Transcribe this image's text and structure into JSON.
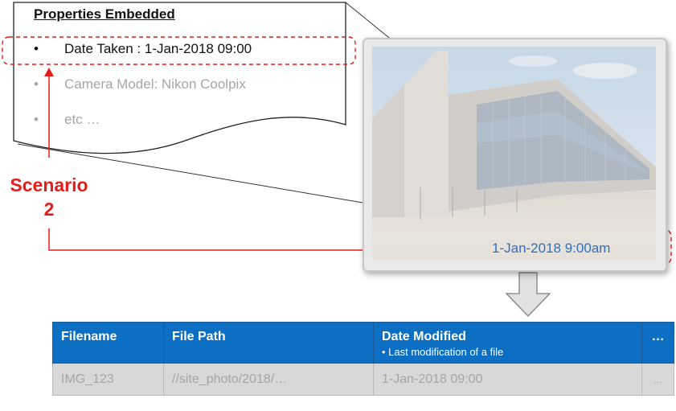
{
  "properties": {
    "title": "Properties Embedded",
    "items": [
      {
        "bullet": "•",
        "text": "Date Taken : 1-Jan-2018 09:00"
      },
      {
        "bullet": "•",
        "text": "Camera Model: Nikon Coolpix"
      },
      {
        "bullet": "•",
        "text": "etc …"
      }
    ]
  },
  "photo": {
    "date_stamp": "1-Jan-2018 9:00am"
  },
  "scenario": {
    "line1": "Scenario",
    "line2": "2"
  },
  "table": {
    "headers": [
      {
        "label": "Filename",
        "sub": ""
      },
      {
        "label": "File Path",
        "sub": ""
      },
      {
        "label": "Date Modified",
        "sub": "•  Last modification of a file"
      },
      {
        "label": "…",
        "sub": ""
      }
    ],
    "row": [
      "IMG_123",
      "//site_photo/2018/…",
      "1-Jan-2018 09:00",
      "…"
    ]
  },
  "colors": {
    "accent_red": "#e51c1c",
    "header_blue": "#0d6fc4",
    "date_blue": "#2f6fbd",
    "muted_text": "#a6a6a6",
    "row_fill": "#d8d8d8"
  }
}
